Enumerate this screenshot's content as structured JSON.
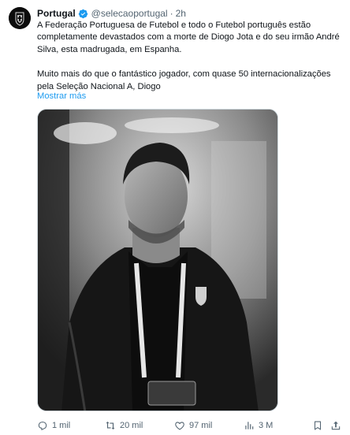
{
  "tweet": {
    "display_name": "Portugal",
    "handle": "@selecaoportugal",
    "separator": "·",
    "time": "2h",
    "paragraphs": [
      "A Federação Portuguesa de Futebol e todo o Futebol português estão completamente devastados com a morte de Diogo Jota e do seu irmão André Silva, esta madrugada, em Espanha.",
      "Muito mais do que o fantástico jogador, com quase 50 internacionalizações pela Seleção Nacional A, Diogo"
    ],
    "show_more": "Mostrar más"
  },
  "actions": {
    "replies": "1 mil",
    "retweets": "20 mil",
    "likes": "97 mil",
    "views": "3 M"
  },
  "icons": {
    "verified": "verified-badge-icon",
    "reply": "reply-icon",
    "retweet": "retweet-icon",
    "like": "heart-icon",
    "views": "views-chart-icon",
    "bookmark": "bookmark-icon",
    "share": "share-icon",
    "more": "more-options-icon"
  },
  "colors": {
    "accent": "#1d9bf0",
    "text": "#0f1419",
    "secondary": "#536471"
  }
}
